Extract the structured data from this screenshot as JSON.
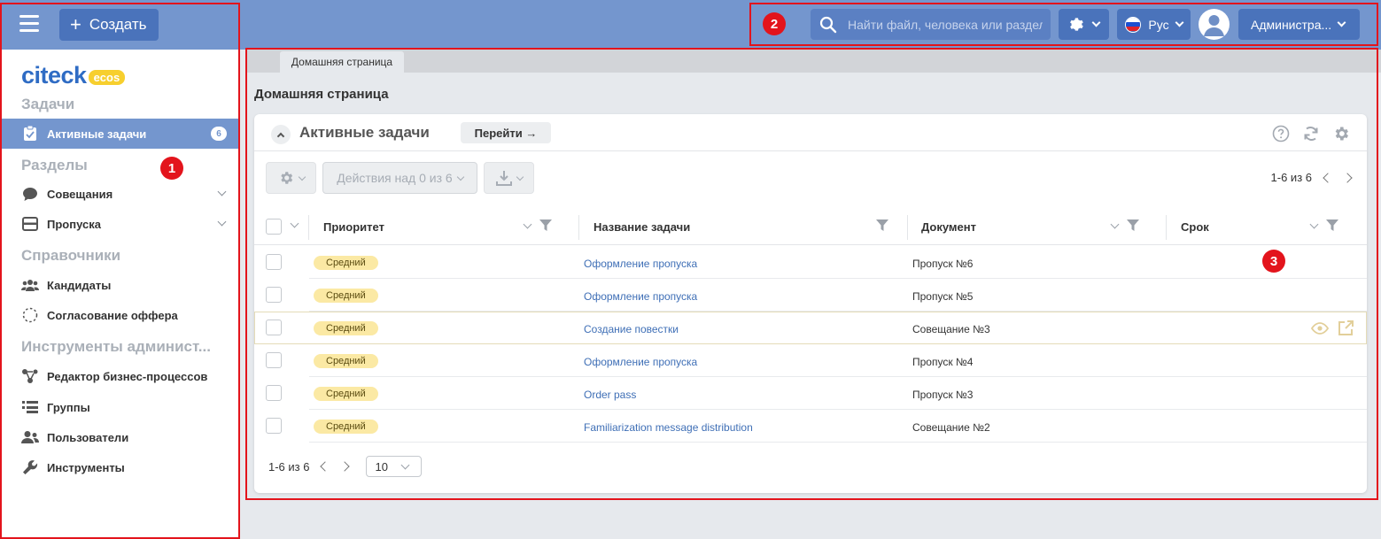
{
  "header": {
    "create_label": "Создать",
    "search_placeholder": "Найти файл, человека или раздел",
    "language": "Рус",
    "user": "Администра..."
  },
  "sidebar": {
    "logo_text": "cіteck",
    "logo_badge": "ecos",
    "sections": {
      "tasks": "Задачи",
      "sections": "Разделы",
      "references": "Справочники",
      "admin": "Инструменты админист..."
    },
    "items": [
      {
        "label": "Активные задачи",
        "badge": "6",
        "icon": "clipboard-icon"
      },
      {
        "label": "Совещания",
        "icon": "chat-bubble-icon"
      },
      {
        "label": "Пропуска",
        "icon": "card-icon"
      },
      {
        "label": "Кандидаты",
        "icon": "people-icon"
      },
      {
        "label": "Согласование оффера",
        "icon": "dashed-circle-icon"
      },
      {
        "label": "Редактор бизнес-процессов",
        "icon": "process-icon"
      },
      {
        "label": "Группы",
        "icon": "groups-icon"
      },
      {
        "label": "Пользователи",
        "icon": "users-icon"
      },
      {
        "label": "Инструменты",
        "icon": "wrench-icon"
      }
    ]
  },
  "main": {
    "tab": "Домашняя страница",
    "page_title": "Домашняя страница",
    "widget": {
      "title": "Активные задачи",
      "goto_label": "Перейти →",
      "actions_label": "Действия над 0 из 6",
      "pager_text": "1-6 из 6",
      "columns": [
        "Приоритет",
        "Название задачи",
        "Документ",
        "Срок"
      ],
      "rows": [
        {
          "priority": "Средний",
          "task": "Оформление пропуска",
          "document": "Пропуск №6"
        },
        {
          "priority": "Средний",
          "task": "Оформление пропуска",
          "document": "Пропуск №5"
        },
        {
          "priority": "Средний",
          "task": "Создание повестки",
          "document": "Совещание №3"
        },
        {
          "priority": "Средний",
          "task": "Оформление пропуска",
          "document": "Пропуск №4"
        },
        {
          "priority": "Средний",
          "task": "Order pass",
          "document": "Пропуск №3"
        },
        {
          "priority": "Средний",
          "task": "Familiarization message distribution",
          "document": "Совещание №2"
        }
      ],
      "page_size": "10"
    }
  },
  "annotations": [
    "1",
    "2",
    "3"
  ],
  "colors": {
    "header": "#7496ce",
    "accent": "#4a73bb",
    "highlight": "#e3141c",
    "priority": "#fbe9a4"
  }
}
